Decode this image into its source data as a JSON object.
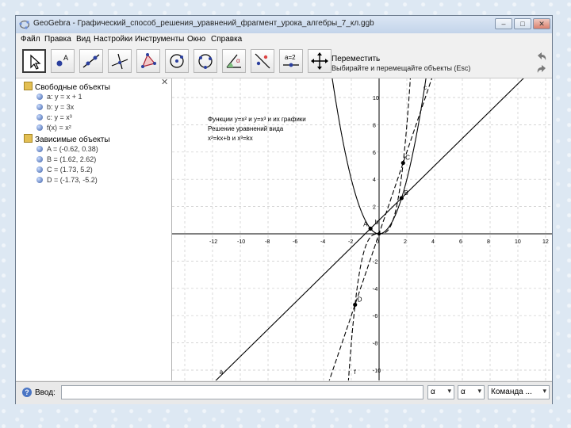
{
  "window": {
    "title": "GeoGebra - Графический_способ_решения_уравнений_фрагмент_урока_алгебры_7_кл.ggb",
    "controls": {
      "minimize": "–",
      "maximize": "□",
      "close": "✕"
    }
  },
  "menu": [
    "Файл",
    "Правка",
    "Вид",
    "Настройки",
    "Инструменты",
    "Окно",
    "Справка"
  ],
  "toolbar": {
    "tools": [
      {
        "name": "move-tool-icon"
      },
      {
        "name": "new-point-tool-icon"
      },
      {
        "name": "line-tool-icon"
      },
      {
        "name": "perpendicular-tool-icon"
      },
      {
        "name": "polygon-tool-icon"
      },
      {
        "name": "circle-tool-icon"
      },
      {
        "name": "circle-three-points-tool-icon"
      },
      {
        "name": "angle-tool-icon"
      },
      {
        "name": "reflect-tool-icon"
      },
      {
        "name": "slider-tool-icon"
      },
      {
        "name": "move-graphics-tool-icon"
      }
    ],
    "help_title": "Переместить",
    "help_desc": "Выбирайте и перемещайте объекты (Esc)"
  },
  "algebra": {
    "free_header": "Свободные объекты",
    "free": [
      "a: y = x + 1",
      "b: y = 3x",
      "c: y = x³",
      "f(x) = x²"
    ],
    "dependent_header": "Зависимые объекты",
    "dependent": [
      "A = (-0.62, 0.38)",
      "B = (1.62, 2.62)",
      "C = (1.73, 5.2)",
      "D = (-1.73, -5.2)"
    ]
  },
  "graphics": {
    "annotation": [
      "Функции y=x² и y=x³ и их графики",
      "Решение уравнений вида",
      "x²=kx+b и x³=kx"
    ],
    "x_ticks": [
      "-12",
      "-10",
      "-8",
      "-6",
      "-4",
      "-2",
      "0",
      "2",
      "4",
      "6",
      "8",
      "10",
      "12"
    ],
    "y_ticks": [
      "10",
      "8",
      "6",
      "4",
      "2",
      "-2",
      "-4",
      "-6",
      "-8",
      "-10"
    ],
    "labels": {
      "a": "a",
      "b": "b",
      "c": "c",
      "f": "f",
      "A": "A",
      "B": "B",
      "C": "C",
      "D": "D"
    },
    "colors": {
      "axis": "#000000",
      "grid": "#c8c8c8",
      "curve": "#000000",
      "point": "#000000"
    }
  },
  "input_bar": {
    "label": "Ввод:",
    "value": "",
    "combo1": "α",
    "combo2": "α",
    "command": "Команда ..."
  }
}
